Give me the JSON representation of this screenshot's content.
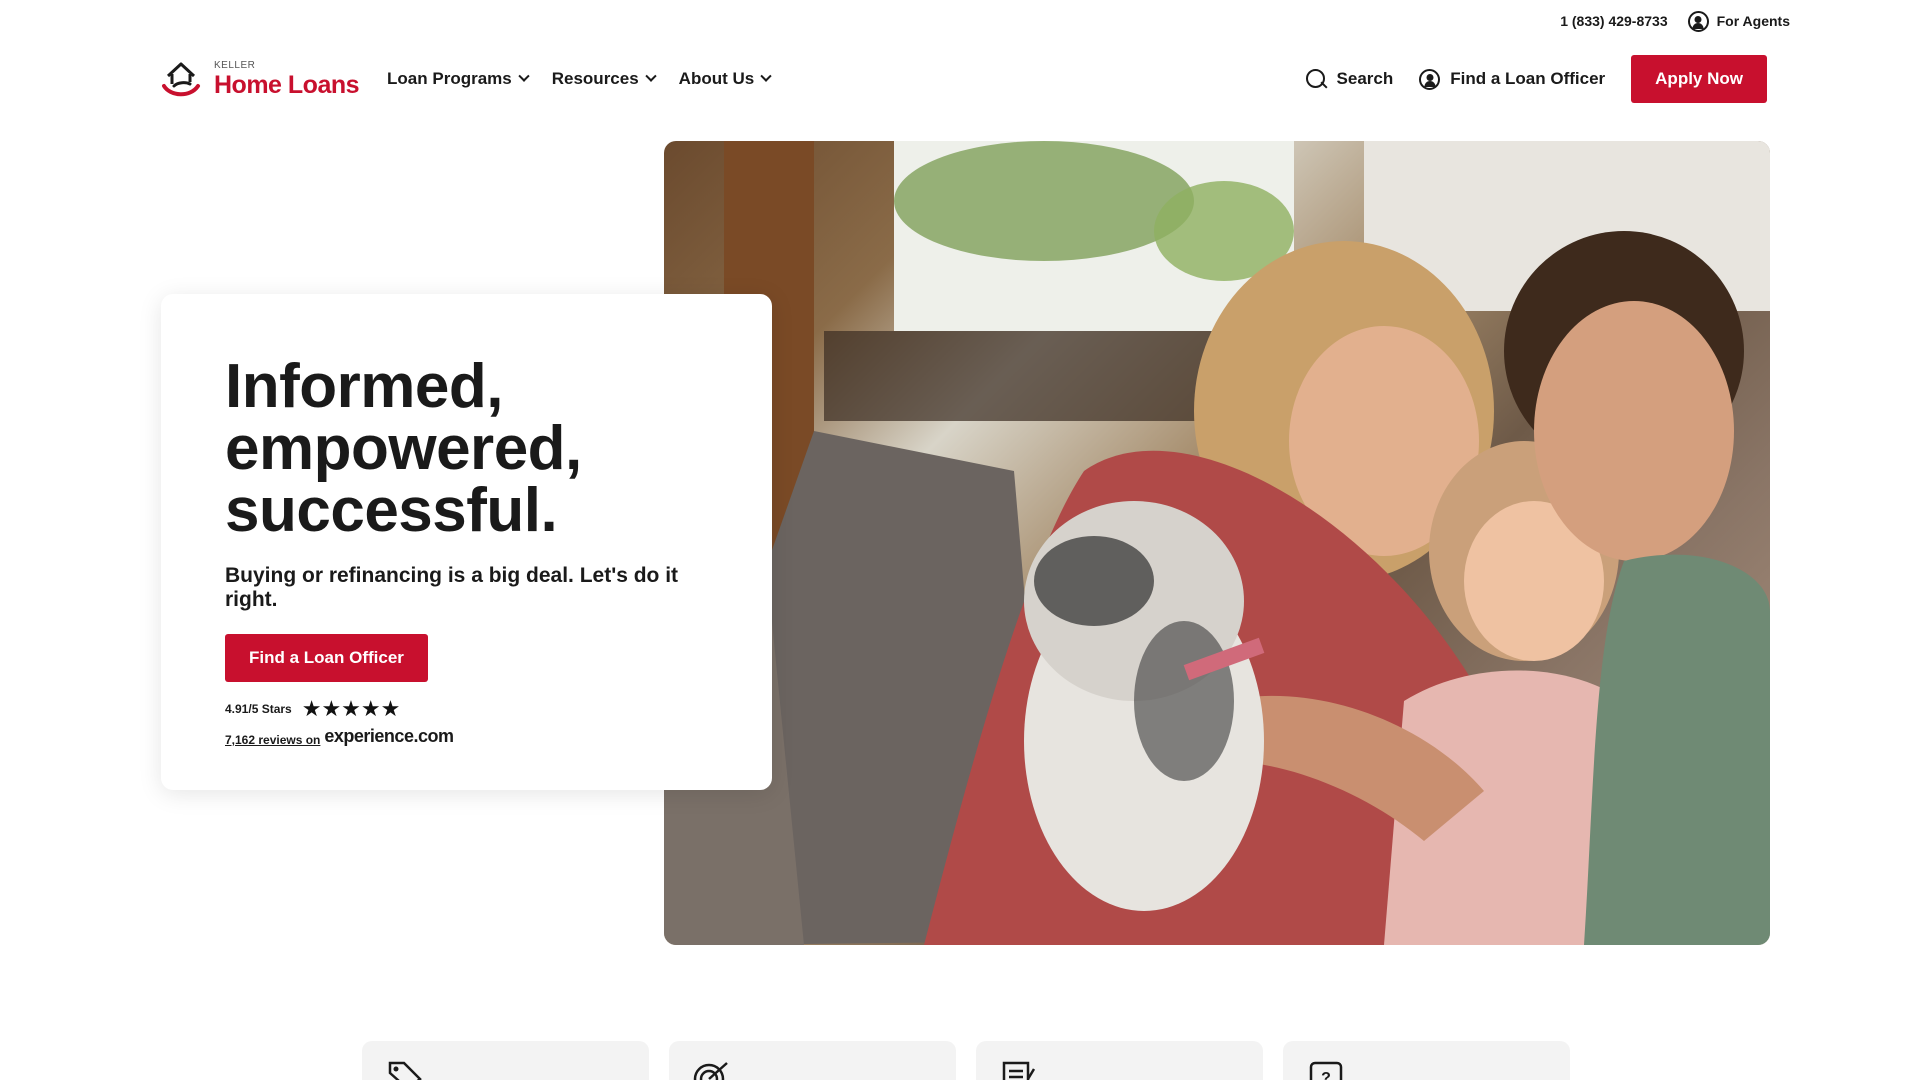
{
  "utility": {
    "phone": "1 (833) 429-8733",
    "agents_label": "For Agents",
    "agents_icon": "user-circle-icon"
  },
  "logo": {
    "small": "KELLER",
    "big": "Home Loans",
    "mark_icon": "house-hand-icon"
  },
  "nav": {
    "items": [
      {
        "label": "Loan Programs"
      },
      {
        "label": "Resources"
      },
      {
        "label": "About Us"
      }
    ]
  },
  "header": {
    "search_label": "Search",
    "find_officer_label": "Find a Loan Officer",
    "apply_label": "Apply Now"
  },
  "hero": {
    "headline_1": "Informed,",
    "headline_2": "empowered,",
    "headline_3": "successful.",
    "subhead": "Buying or refinancing is a big deal. Let's do it right.",
    "cta_label": "Find a Loan Officer",
    "rating_text": "4.91/5 Stars",
    "stars": "★★★★★",
    "star_count": 5,
    "reviews_text": "7,162 reviews on",
    "reviews_brand": "experience.com",
    "photo_alt": "family-with-dog-photo"
  },
  "features": [
    {
      "icon": "tag-icon"
    },
    {
      "icon": "target-icon"
    },
    {
      "icon": "checklist-icon"
    },
    {
      "icon": "question-icon"
    }
  ],
  "colors": {
    "brand_red": "#c8102e",
    "text": "#1a1a1a",
    "card_bg": "#f3f3f3"
  }
}
